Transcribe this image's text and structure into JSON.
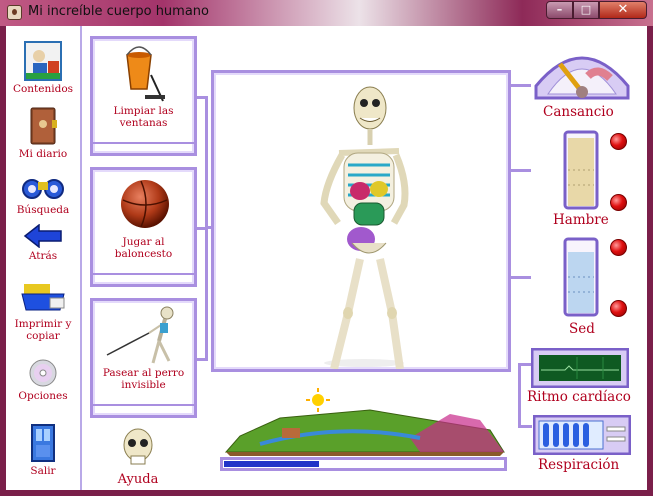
{
  "window": {
    "title": "Mi increíble cuerpo humano",
    "min_glyph": "–",
    "max_glyph": "□",
    "close_glyph": "✕"
  },
  "sidebar": {
    "items": [
      {
        "label": "Contenidos",
        "icon": "contents-icon"
      },
      {
        "label": "Mi diario",
        "icon": "diary-icon"
      },
      {
        "label": "Búsqueda",
        "icon": "binoculars-icon"
      },
      {
        "label": "Atrás",
        "icon": "back-arrow-icon"
      },
      {
        "label": "Imprimir y copiar",
        "icon": "printer-icon"
      },
      {
        "label": "Opciones",
        "icon": "cd-options-icon"
      },
      {
        "label": "Salir",
        "icon": "exit-door-icon"
      }
    ]
  },
  "activities": [
    {
      "label": "Limpiar las ventanas",
      "icon": "bucket-icon"
    },
    {
      "label": "Jugar al baloncesto",
      "icon": "basketball-icon"
    },
    {
      "label": "Pasear al perro invisible",
      "icon": "skeleton-walking-icon"
    }
  ],
  "help": {
    "label": "Ayuda"
  },
  "gauges": {
    "tiredness": {
      "label": "Cansancio"
    },
    "hunger": {
      "label": "Hambre",
      "level": 0.95
    },
    "thirst": {
      "label": "Sed",
      "level": 0.85
    },
    "heart": {
      "label": "Ritmo cardíaco"
    },
    "breathing": {
      "label": "Respiración"
    }
  },
  "progress": {
    "value": 0.34
  },
  "colors": {
    "accent": "#a98fe0",
    "label_red": "#b0001e",
    "progress_blue": "#2234c8"
  }
}
